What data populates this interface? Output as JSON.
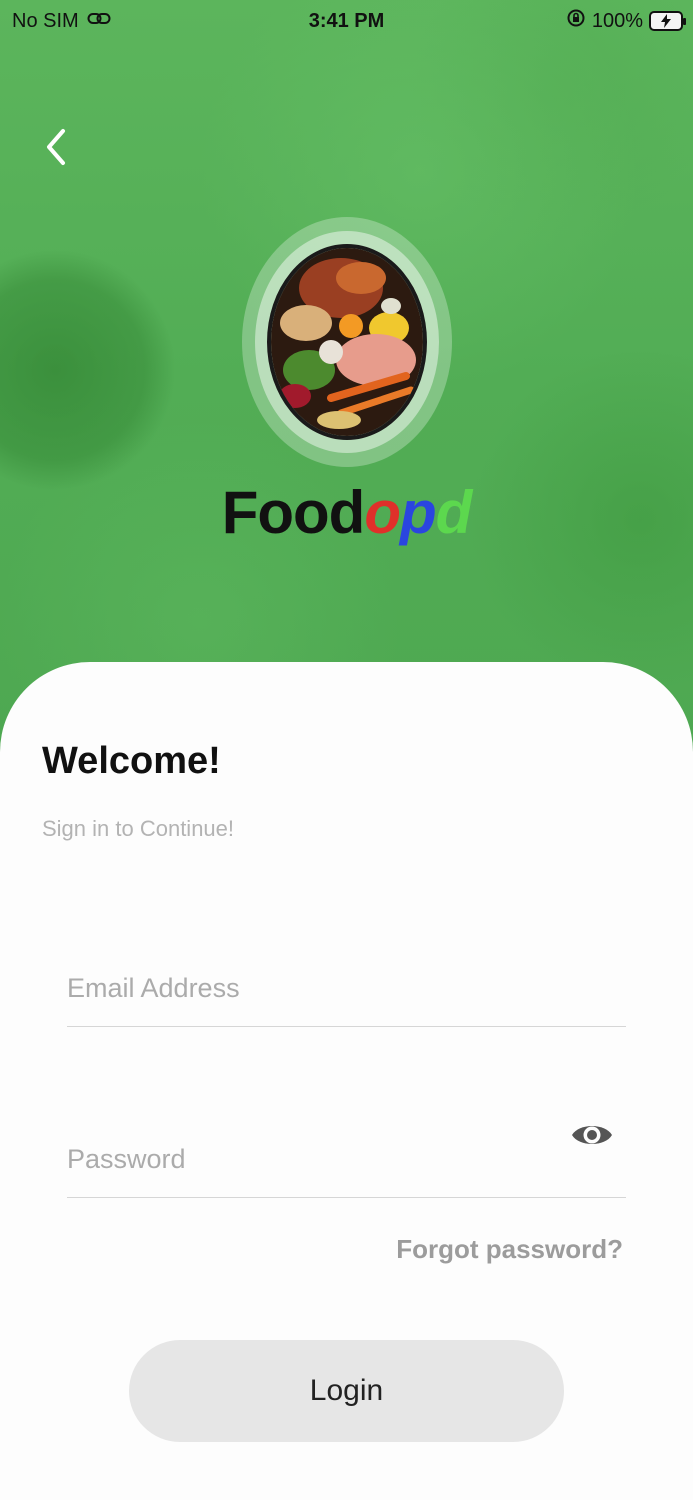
{
  "status_bar": {
    "carrier": "No SIM",
    "time": "3:41 PM",
    "battery": "100%"
  },
  "brand": {
    "part1": "Food",
    "part2": "o",
    "part3": "p",
    "part4": "d"
  },
  "login_card": {
    "title": "Welcome!",
    "subtitle": "Sign in to Continue!",
    "email_placeholder": "Email Address",
    "password_placeholder": "Password",
    "forgot_label": "Forgot password?",
    "login_label": "Login"
  },
  "icons": [
    "back-chevron-icon",
    "link-icon",
    "orientation-lock-icon",
    "battery-charging-icon",
    "eye-icon"
  ],
  "colors": {
    "hero_green": "#52ad55",
    "brand_red": "#e0302a",
    "brand_blue": "#2a45e0",
    "brand_green": "#5cd84e",
    "button_gray": "#e6e6e6"
  }
}
